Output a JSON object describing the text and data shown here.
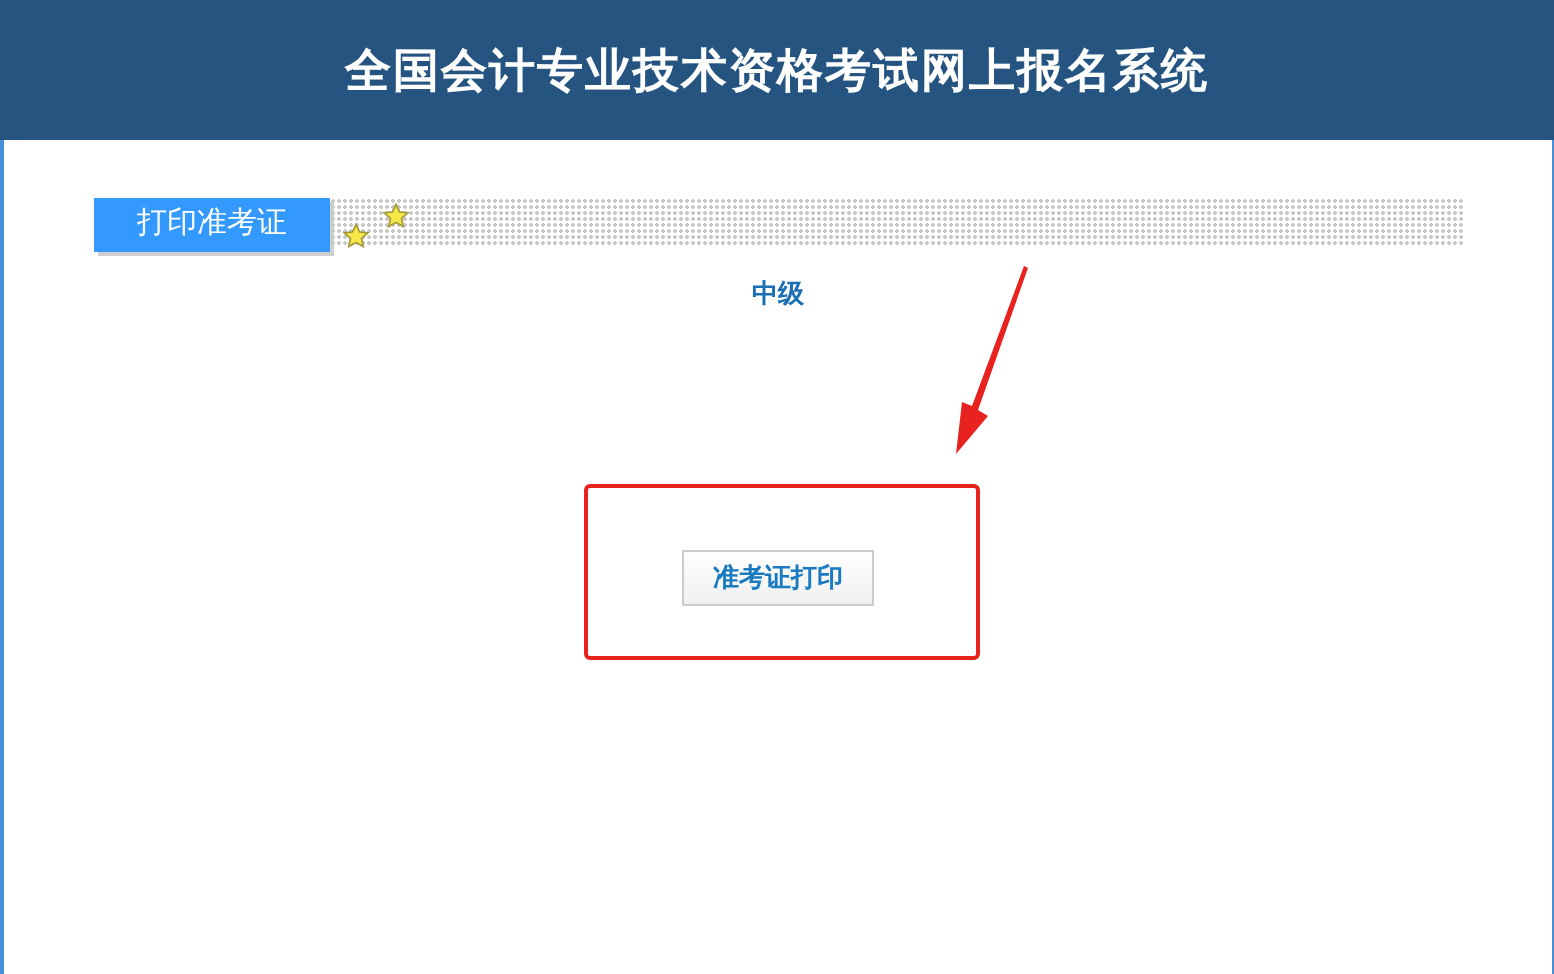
{
  "header": {
    "title": "全国会计专业技术资格考试网上报名系统"
  },
  "section": {
    "label": "打印准考证"
  },
  "level_title": "中级",
  "print_button": {
    "label": "准考证打印"
  },
  "annotation": {
    "kind": "highlight_box_with_arrow"
  }
}
